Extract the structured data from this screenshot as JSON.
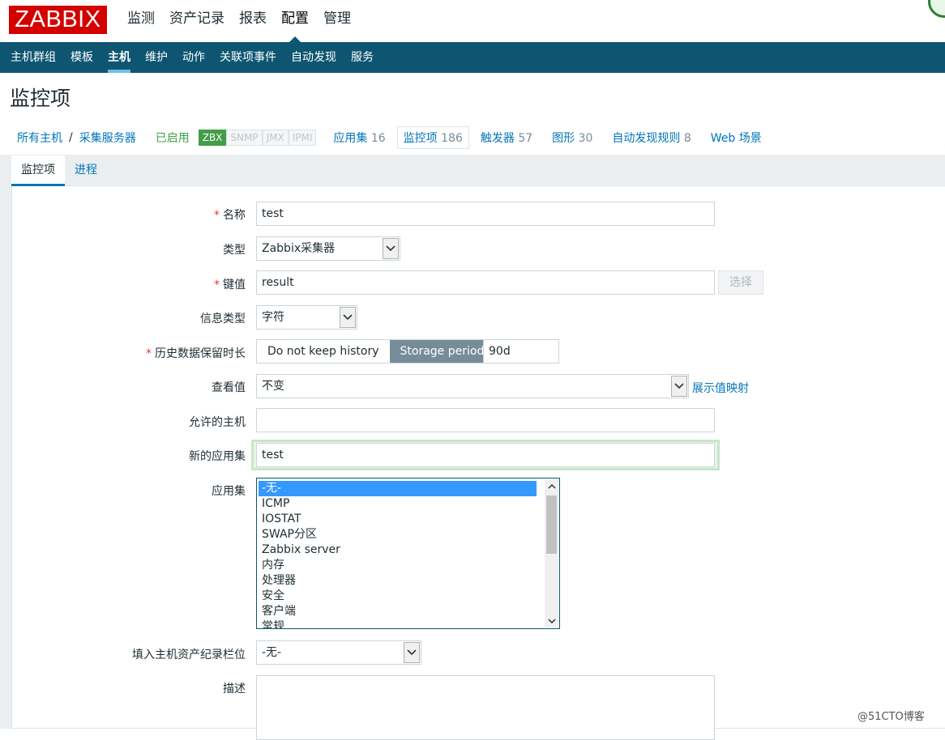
{
  "brand": {
    "logo": "ZABBIX"
  },
  "top_nav": [
    "监测",
    "资产记录",
    "报表",
    "配置",
    "管理"
  ],
  "sub_nav": [
    "主机群组",
    "模板",
    "主机",
    "维护",
    "动作",
    "关联项事件",
    "自动发现",
    "服务"
  ],
  "page_title": "监控项",
  "host_bar": {
    "all_hosts": "所有主机",
    "separator": "/",
    "host_name": "采集服务器",
    "status": "已启用",
    "availability": [
      "ZBX",
      "SNMP",
      "JMX",
      "IPMI"
    ],
    "tabs": [
      {
        "label": "应用集",
        "count": "16"
      },
      {
        "label": "监控项",
        "count": "186"
      },
      {
        "label": "触发器",
        "count": "57"
      },
      {
        "label": "图形",
        "count": "30"
      },
      {
        "label": "自动发现规则",
        "count": "8"
      },
      {
        "label": "Web 场景",
        "count": ""
      }
    ]
  },
  "form_tabs": [
    "监控项",
    "进程"
  ],
  "form": {
    "name": {
      "label": "名称",
      "value": "test"
    },
    "type": {
      "label": "类型",
      "value": "Zabbix采集器"
    },
    "key": {
      "label": "键值",
      "value": "result",
      "button": "选择"
    },
    "info_type": {
      "label": "信息类型",
      "value": "字符"
    },
    "history": {
      "label": "历史数据保留时长",
      "options": [
        "Do not keep history",
        "Storage period"
      ],
      "value": "90d"
    },
    "show_value": {
      "label": "查看值",
      "value": "不变",
      "link": "展示值映射"
    },
    "allowed_hosts": {
      "label": "允许的主机",
      "value": ""
    },
    "new_app": {
      "label": "新的应用集",
      "value": "test"
    },
    "applications": {
      "label": "应用集",
      "options": [
        "-无-",
        "ICMP",
        "IOSTAT",
        "SWAP分区",
        "Zabbix server",
        "内存",
        "处理器",
        "安全",
        "客户端",
        "常规"
      ]
    },
    "inventory": {
      "label": "填入主机资产纪录栏位",
      "value": "-无-"
    },
    "description": {
      "label": "描述",
      "value": ""
    },
    "required_mark": "*"
  },
  "watermark": "@51CTO博客",
  "colors": {
    "brand_red": "#d40000",
    "nav_blue": "#0e5571",
    "link_blue": "#0275b8",
    "green": "#429e47"
  }
}
